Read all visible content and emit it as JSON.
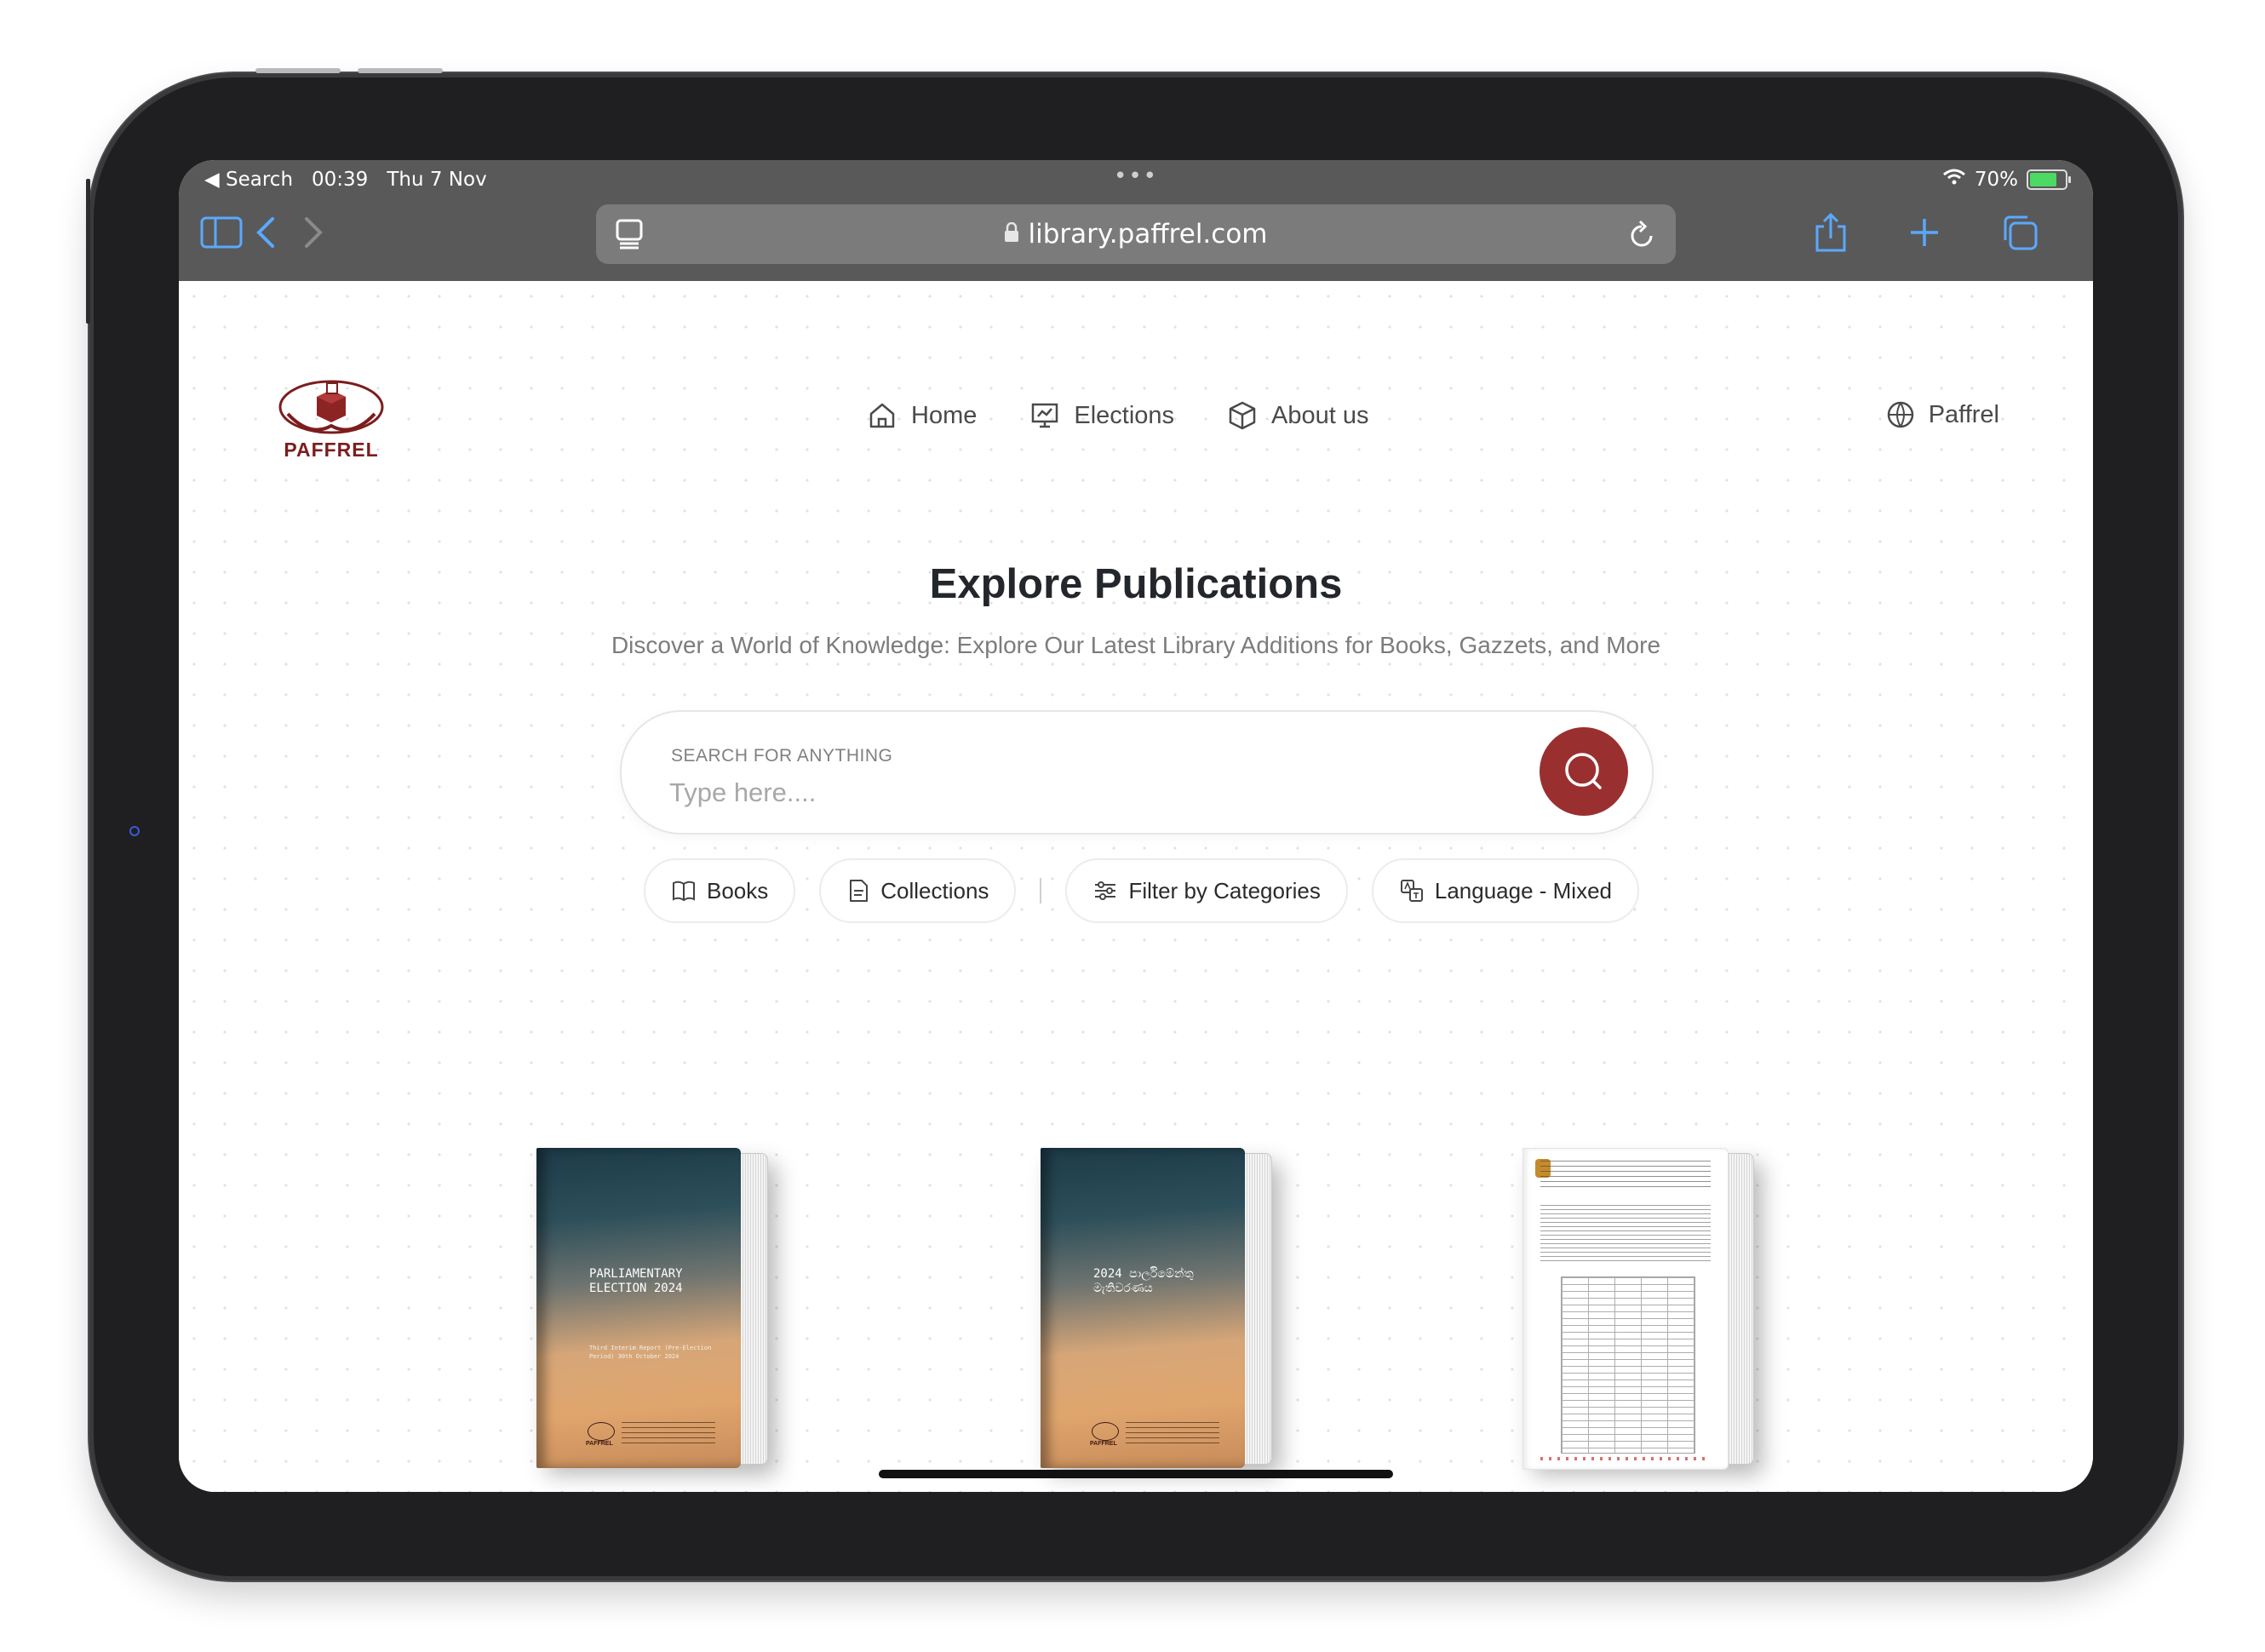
{
  "status_bar": {
    "back_label": "◀ Search",
    "time": "00:39",
    "date": "Thu 7 Nov",
    "battery": "70%"
  },
  "browser": {
    "url": "library.paffrel.com"
  },
  "site": {
    "brand": "PAFFREL",
    "nav": {
      "home": "Home",
      "elections": "Elections",
      "about": "About us",
      "org": "Paffrel"
    },
    "title": "Explore Publications",
    "subtitle": "Discover a World of Knowledge: Explore Our Latest Library Additions for Books, Gazzets, and More",
    "search": {
      "label": "SEARCH FOR ANYTHING",
      "placeholder": "Type here...."
    },
    "filters": {
      "books": "Books",
      "collections": "Collections",
      "categories": "Filter by Categories",
      "language": "Language - Mixed"
    },
    "publications": [
      {
        "cover_title": "PARLIAMENTARY ELECTION 2024",
        "cover_subtitle": "Third Interim Report (Pre-Election Period) 30th October 2024",
        "cover_brand": "PAFFREL"
      },
      {
        "cover_title": "2024 පාර්ලිමේන්තු මැතිවරණය",
        "cover_subtitle": "",
        "cover_brand": "PAFFREL"
      },
      {
        "cover_title": "",
        "cover_subtitle": "",
        "cover_brand": ""
      }
    ]
  },
  "colors": {
    "accent": "#9a2f30",
    "brand": "#7c1d1d",
    "browser_chrome": "#595959"
  }
}
